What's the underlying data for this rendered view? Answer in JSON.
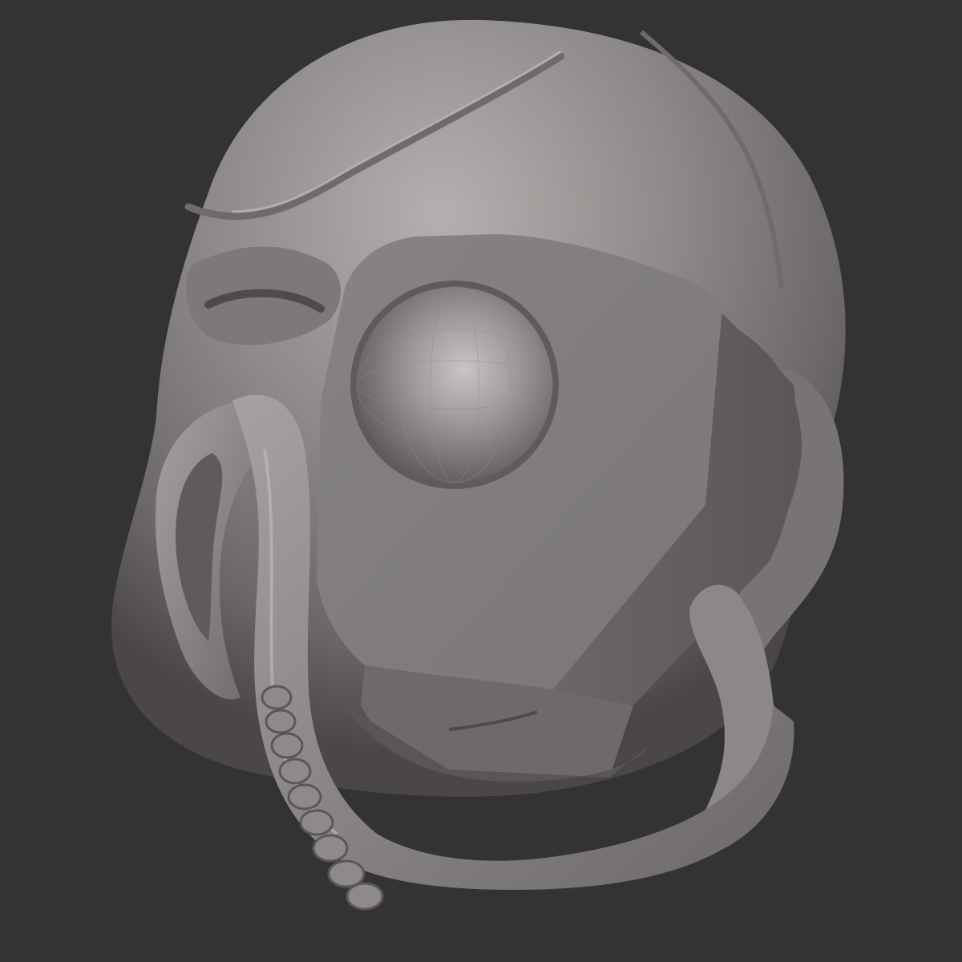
{
  "viewport": {
    "background": "#333333",
    "model_base_color": "#8a8685",
    "model_highlight_color": "#bdbab9",
    "model_shadow_color": "#4e4b4a",
    "cut_face_color": "#7d7a79",
    "sphere_color": "#a6a3a2"
  },
  "model": {
    "subject": "skull-sculpt",
    "features": [
      "cranium",
      "eye-socket-block-cut",
      "eyeball-sphere",
      "cheek-bone-loop",
      "jaw-bone",
      "teeth-row"
    ]
  }
}
